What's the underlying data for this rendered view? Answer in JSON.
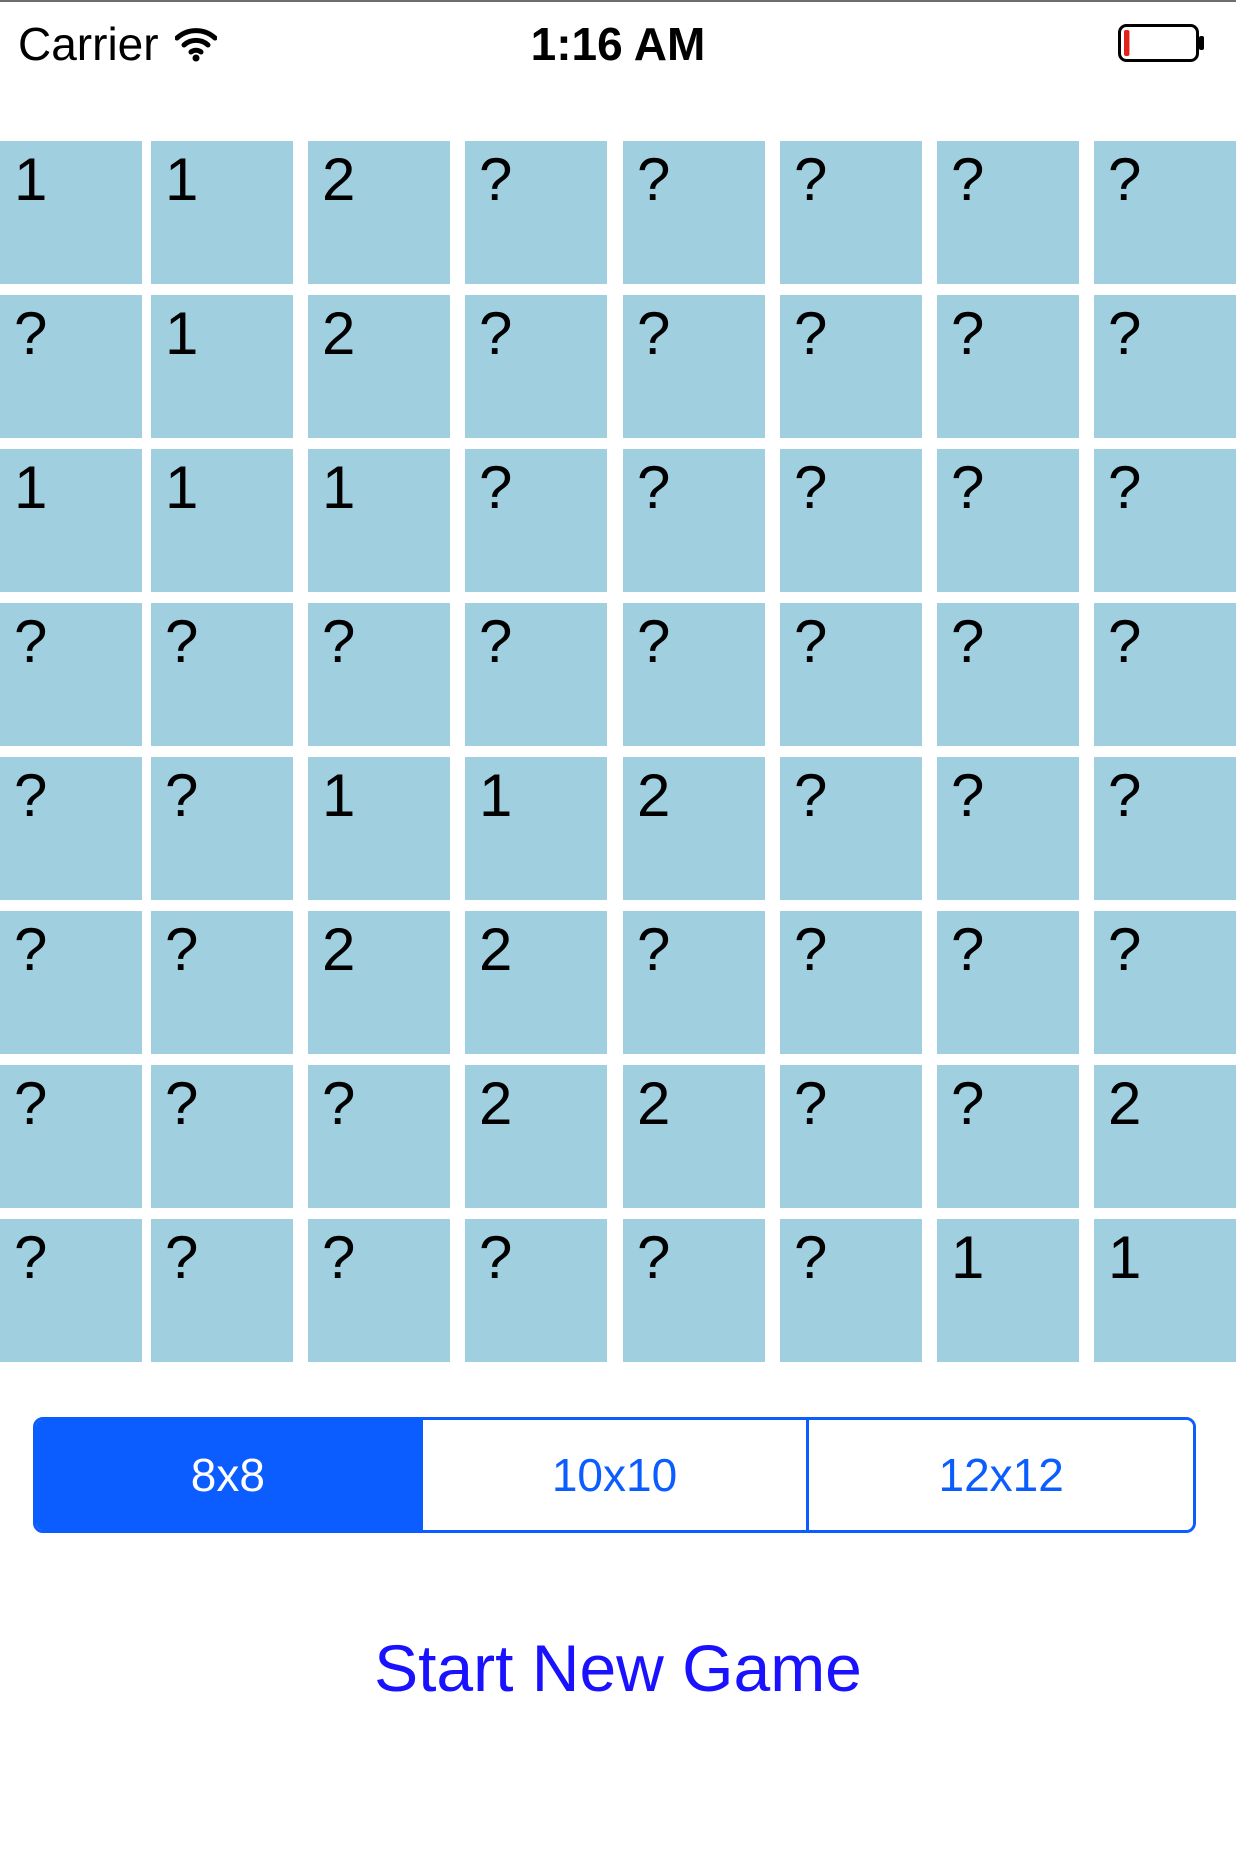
{
  "status_bar": {
    "carrier": "Carrier",
    "time": "1:16 AM",
    "wifi_icon": "wifi-icon",
    "battery_icon": "battery-low-icon",
    "battery_level": 0.08,
    "battery_color": "#e0241c"
  },
  "board": {
    "cell_color": "#a0cfe0",
    "rows": [
      [
        "1",
        "1",
        "2",
        "?",
        "?",
        "?",
        "?",
        "?"
      ],
      [
        "?",
        "1",
        "2",
        "?",
        "?",
        "?",
        "?",
        "?"
      ],
      [
        "1",
        "1",
        "1",
        "?",
        "?",
        "?",
        "?",
        "?"
      ],
      [
        "?",
        "?",
        "?",
        "?",
        "?",
        "?",
        "?",
        "?"
      ],
      [
        "?",
        "?",
        "1",
        "1",
        "2",
        "?",
        "?",
        "?"
      ],
      [
        "?",
        "?",
        "2",
        "2",
        "?",
        "?",
        "?",
        "?"
      ],
      [
        "?",
        "?",
        "?",
        "2",
        "2",
        "?",
        "?",
        "2"
      ],
      [
        "?",
        "?",
        "?",
        "?",
        "?",
        "?",
        "1",
        "1"
      ]
    ]
  },
  "size_selector": {
    "options": [
      "8x8",
      "10x10",
      "12x12"
    ],
    "selected": "8x8",
    "accent_color": "#0b5dff"
  },
  "start_button": {
    "label": "Start New Game",
    "color": "#1a12ff"
  }
}
